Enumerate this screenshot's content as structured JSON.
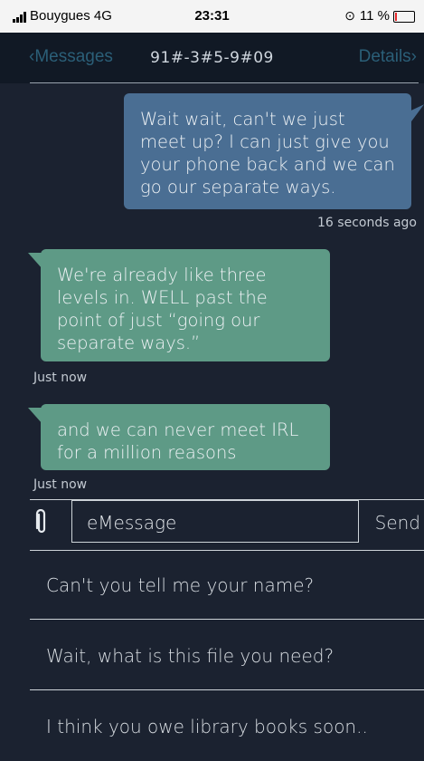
{
  "status_bar": {
    "carrier": "Bouygues  4G",
    "time": "23:31",
    "battery_percent": "11 %",
    "battery_level": 0.11,
    "battery_color": "#e5292b"
  },
  "nav": {
    "back_label": "Messages",
    "title": "91#-3#5-9#09",
    "details_label": "Details"
  },
  "messages": [
    {
      "direction": "sent",
      "text": "Wait wait, can't we just meet up? I can just give you your phone back and we can go our separate ways.",
      "timestamp": "16 seconds ago"
    },
    {
      "direction": "received",
      "text": "We're already like three levels in. WELL past the point of just “going our separate ways.”",
      "timestamp": "Just now"
    },
    {
      "direction": "received",
      "text": "and we can never meet IRL for a million reasons",
      "timestamp": "Just now"
    }
  ],
  "compose": {
    "placeholder": "eMessage",
    "send_label": "Send"
  },
  "reply_options": [
    "Can't you tell me your name?",
    "Wait, what is this file you need?",
    "I think you owe library books soon.."
  ],
  "colors": {
    "background": "#1b2230",
    "sent_bubble": "#4a6e93",
    "received_bubble": "#5e9a86",
    "link": "#2b5f78"
  }
}
